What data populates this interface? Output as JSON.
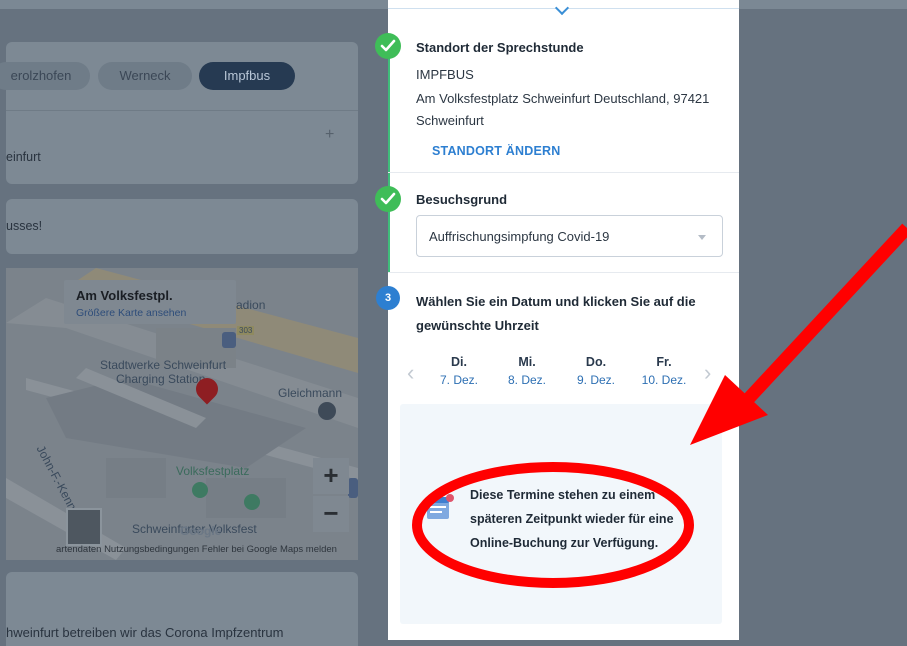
{
  "background": {
    "location_tabs": [
      {
        "label": "erolzhofen",
        "active": false
      },
      {
        "label": "Werneck",
        "active": false
      },
      {
        "label": "Impfbus",
        "active": true
      }
    ],
    "plus": "+",
    "city_fragment": "einfurt",
    "notice_fragment": "usses!",
    "map": {
      "popup_title": "Am Volksfestpl.",
      "popup_link": "Größere Karte ansehen",
      "labels": {
        "stadion": "adion",
        "road_number": "303",
        "stadtwerke_1": "Stadtwerke Schweinfurt",
        "stadtwerke_2": "Charging Station",
        "gleichmann": "Gleichmann",
        "street": "John-F.-Kenne",
        "volksfestplatz": "Volksfestplatz",
        "schweinfurter_volksfest": "Schweinfurter Volksfest",
        "google": "Google"
      },
      "zoom_in": "+",
      "zoom_out": "−",
      "footer": "artendaten   Nutzungsbedingungen   Fehler bei Google Maps melden"
    },
    "bottom_fragment": "hweinfurt betreiben wir das Corona Impfzentrum"
  },
  "panel": {
    "location": {
      "title": "Standort der Sprechstunde",
      "name": "IMPFBUS",
      "address_line1": "Am Volksfestplatz Schweinfurt Deutschland, 97421",
      "address_line2": "Schweinfurt",
      "change_link": "STANDORT ÄNDERN"
    },
    "reason": {
      "title": "Besuchsgrund",
      "selected": "Auffrischungsimpfung Covid-19"
    },
    "step3": {
      "number": "3",
      "title": "Wählen Sie ein Datum und klicken Sie auf die gewünschte Uhrzeit"
    },
    "days": [
      {
        "day": "Di.",
        "date": "7. Dez."
      },
      {
        "day": "Mi.",
        "date": "8. Dez."
      },
      {
        "day": "Do.",
        "date": "9. Dez."
      },
      {
        "day": "Fr.",
        "date": "10. Dez."
      }
    ],
    "prev_icon": "‹",
    "next_icon": "›",
    "info_message": "Diese Termine stehen zu einem späteren Zeitpunkt wieder für eine Online-Buchung zur Verfügung."
  },
  "annotation": {
    "color": "#ff0000",
    "shapes": [
      "red-arrow",
      "red-ellipse"
    ]
  },
  "colors": {
    "accent_blue": "#2d7fd1",
    "success_green": "#3fbd58",
    "info_bg": "#f2f7fb"
  }
}
